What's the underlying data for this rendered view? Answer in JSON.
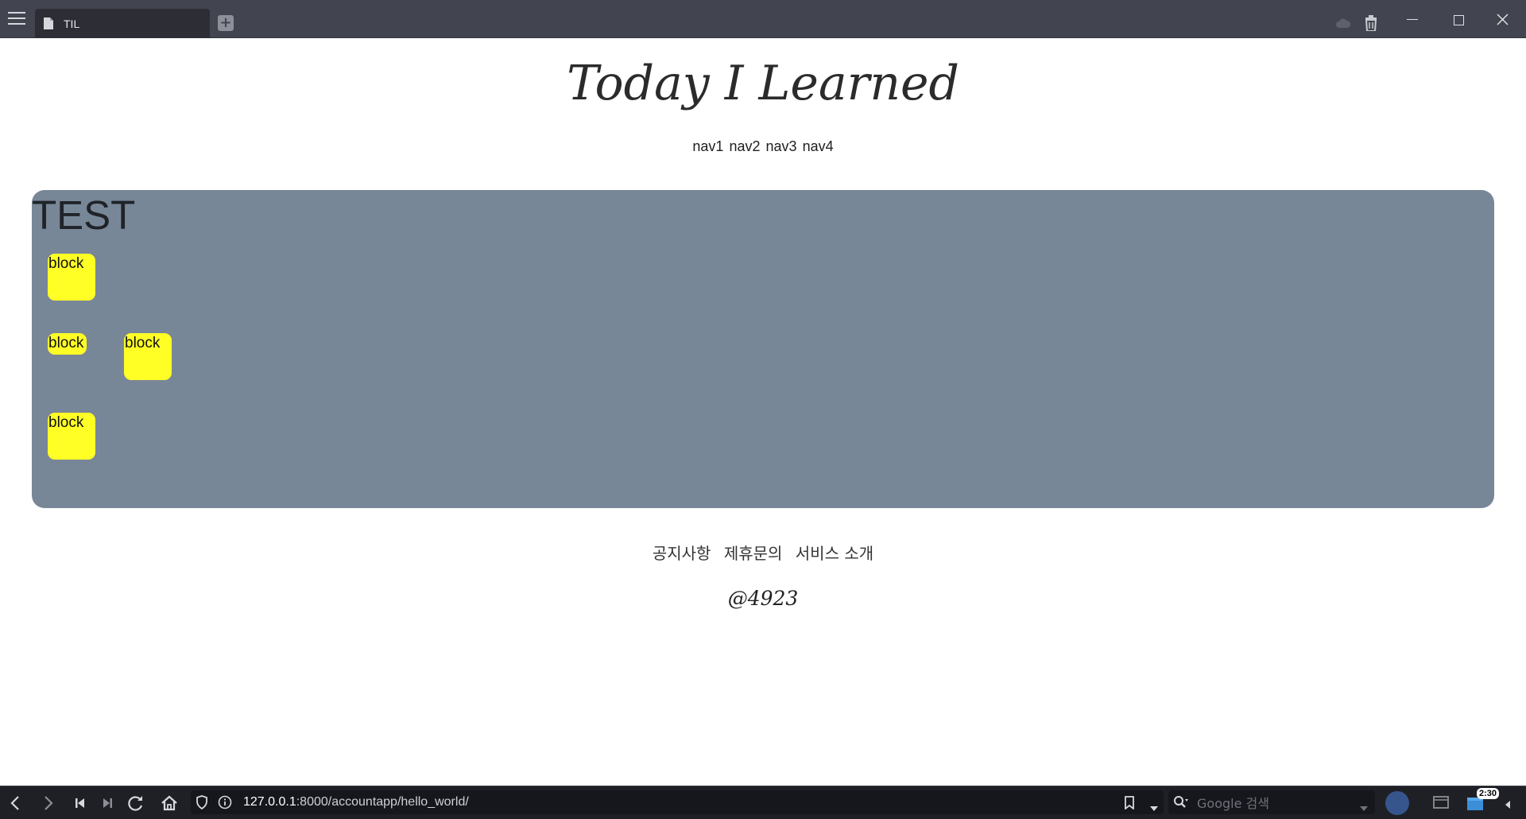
{
  "browser": {
    "tab_title": "TIL",
    "url_host": "127.0.0.1",
    "url_rest": ":8000/accountapp/hello_world/",
    "search_placeholder": "Google 검색",
    "clock": "2:30"
  },
  "page": {
    "title": "Today I Learned",
    "nav": [
      "nav1",
      "nav2",
      "nav3",
      "nav4"
    ],
    "panel_heading": "TEST",
    "blocks": [
      "block",
      "block",
      "block",
      "block"
    ],
    "footer_links": [
      "공지사항",
      "제휴문의",
      "서비스 소개"
    ],
    "footer_handle": "@4923"
  },
  "colors": {
    "panel_bg": "#788797",
    "block_bg": "#ffff26",
    "topbar_bg": "#42444f",
    "bottombar_bg": "#1f2026"
  },
  "icons": {
    "menu": "hamburger-menu-icon",
    "tab": "document-icon",
    "new_tab": "plus-icon",
    "sync": "cloud-icon",
    "trash": "trash-icon",
    "back": "chevron-left-icon",
    "forward": "chevron-right-icon",
    "rewind": "skip-back-icon",
    "fast_forward": "skip-forward-icon",
    "reload": "reload-icon",
    "home": "home-icon",
    "security": "shield-icon",
    "site_info": "info-icon",
    "bookmark": "bookmark-icon",
    "search": "search-icon"
  }
}
